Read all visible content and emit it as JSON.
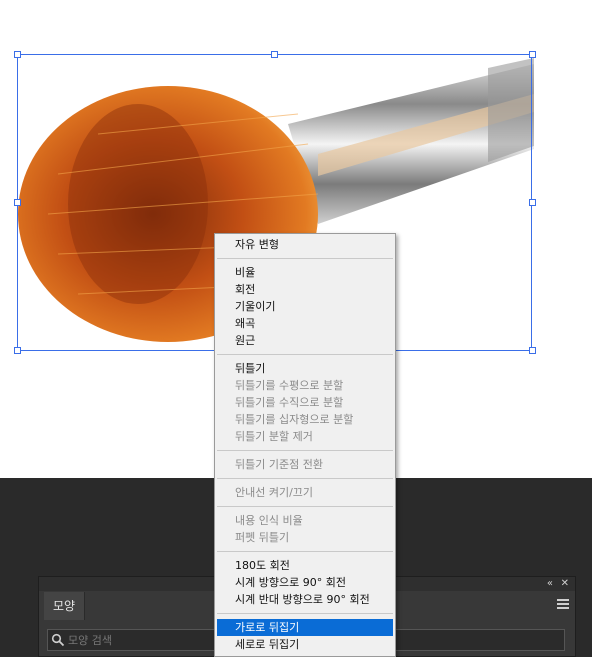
{
  "context_menu": {
    "items": [
      {
        "label": "자유 변형",
        "enabled": true
      },
      {
        "label": "비율",
        "enabled": true
      },
      {
        "label": "회전",
        "enabled": true
      },
      {
        "label": "기울이기",
        "enabled": true
      },
      {
        "label": "왜곡",
        "enabled": true
      },
      {
        "label": "원근",
        "enabled": true
      },
      {
        "label": "뒤틀기",
        "enabled": true
      },
      {
        "label": "뒤틀기를 수평으로 분할",
        "enabled": false
      },
      {
        "label": "뒤틀기를 수직으로 분할",
        "enabled": false
      },
      {
        "label": "뒤틀기를 십자형으로 분할",
        "enabled": false
      },
      {
        "label": "뒤틀기 분할 제거",
        "enabled": false
      },
      {
        "label": "뒤틀기 기준점 전환",
        "enabled": false
      },
      {
        "label": "안내선 켜기/끄기",
        "enabled": false
      },
      {
        "label": "내용 인식 비율",
        "enabled": false
      },
      {
        "label": "퍼펫 뒤틀기",
        "enabled": false
      },
      {
        "label": "180도 회전",
        "enabled": true
      },
      {
        "label": "시계 방향으로 90° 회전",
        "enabled": true
      },
      {
        "label": "시계 반대 방향으로 90° 회전",
        "enabled": true
      },
      {
        "label": "가로로 뒤집기",
        "enabled": true,
        "selected": true
      },
      {
        "label": "세로로 뒤집기",
        "enabled": true
      }
    ]
  },
  "panel": {
    "tab_label": "모양",
    "collapse_icon": "double-chevron-icon",
    "close_icon": "close-icon",
    "menu_icon": "hamburger-menu-icon",
    "search_placeholder": "모양 검색",
    "search_icon": "search-icon"
  },
  "colors": {
    "selection_highlight": "#0a6cd6",
    "bounding_box": "#3a6ee8",
    "menu_bg": "#f0f0f0",
    "workspace_bg": "#2a2a2a",
    "panel_bg": "#383838"
  }
}
